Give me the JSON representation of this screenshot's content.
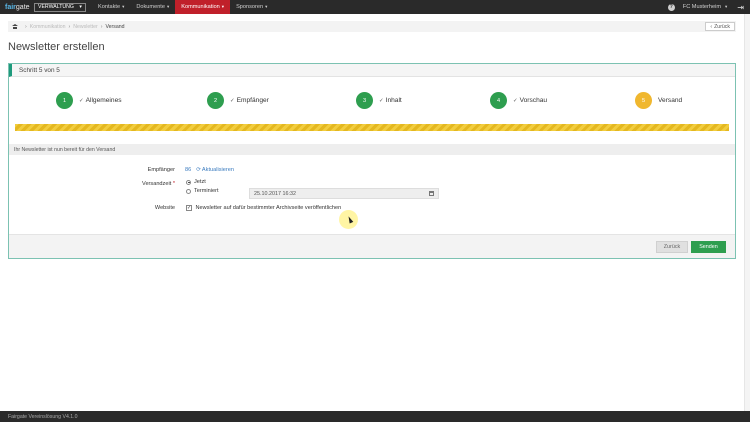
{
  "topbar": {
    "brand_main": "fair",
    "brand_sub": "gate",
    "admin_select": "VERWALTUNG",
    "nav": [
      {
        "label": "Kontakte",
        "active": false
      },
      {
        "label": "Dokumente",
        "active": false
      },
      {
        "label": "Kommunikation",
        "active": true
      },
      {
        "label": "Sponsoren",
        "active": false
      }
    ],
    "help_icon": "?",
    "club_name": "FC Musterheim",
    "logout_icon": "logout-icon"
  },
  "breadcrumb": {
    "items": [
      "Kommunikation",
      "Newsletter"
    ],
    "current": "Versand",
    "back_label": "Zurück"
  },
  "page_title": "Newsletter erstellen",
  "wizard": {
    "header": "Schritt 5 von 5",
    "steps": [
      {
        "number": "1",
        "label": "Allgemeines",
        "done": true
      },
      {
        "number": "2",
        "label": "Empfänger",
        "done": true
      },
      {
        "number": "3",
        "label": "Inhalt",
        "done": true
      },
      {
        "number": "4",
        "label": "Vorschau",
        "done": true
      },
      {
        "number": "5",
        "label": "Versand",
        "done": false
      }
    ],
    "progress_percent": 100,
    "info": "Ihr Newsletter ist nun bereit für den Versand"
  },
  "form": {
    "recipients_label": "Empfänger",
    "recipients_count": "86",
    "refresh_label": "Aktualisieren",
    "send_time_label": "Versandzeit",
    "required_marker": "*",
    "option_now": "Jetzt",
    "option_scheduled": "Terminiert",
    "selected_option": "Jetzt",
    "scheduled_value": "25.10.2017 16:32",
    "website_label": "Website",
    "website_checkbox_label": "Newsletter auf dafür bestimmter Archivseite veröffentlichen",
    "website_checked": true
  },
  "buttons": {
    "back": "Zurück",
    "send": "Senden"
  },
  "footer": {
    "text": "Fairgate Vereinslösung V4.1.0"
  },
  "colors": {
    "done_step": "#2e9e4f",
    "current_step": "#f0b72f",
    "nav_active": "#c0202a",
    "panel_accent": "#1e9a7c"
  }
}
